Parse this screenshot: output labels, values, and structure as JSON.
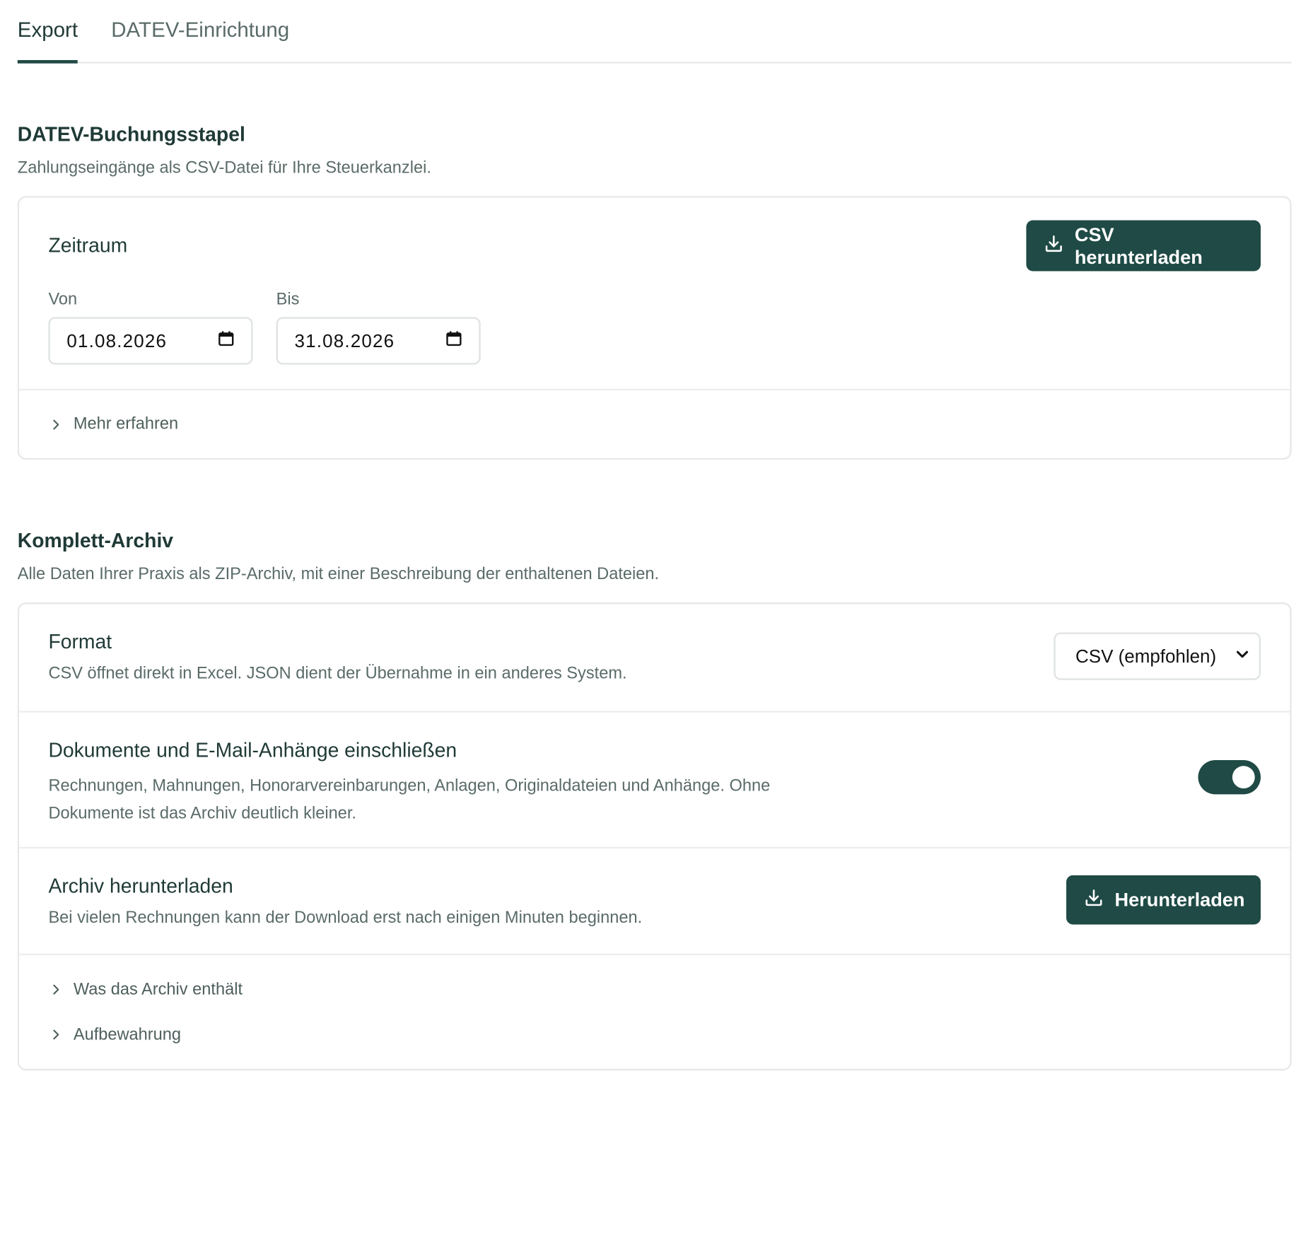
{
  "tabs": [
    {
      "label": "Export",
      "active": true
    },
    {
      "label": "DATEV-Einrichtung",
      "active": false
    }
  ],
  "datev": {
    "title": "DATEV-Buchungsstapel",
    "subtitle": "Zahlungseingänge als CSV-Datei für Ihre Steuerkanzlei.",
    "period_title": "Zeitraum",
    "download_button": "CSV herunterladen",
    "from_label": "Von",
    "from_value": "01.08.2026",
    "to_label": "Bis",
    "to_value": "31.08.2026",
    "more_info": "Mehr erfahren"
  },
  "archive": {
    "title": "Komplett-Archiv",
    "subtitle": "Alle Daten Ihrer Praxis als ZIP-Archiv, mit einer Beschreibung der enthaltenen Dateien.",
    "format_title": "Format",
    "format_desc": "CSV öffnet direkt in Excel. JSON dient der Übernahme in ein anderes System.",
    "format_selected": "CSV (empfohlen)",
    "docs_title": "Dokumente und E-Mail-Anhänge einschließen",
    "docs_desc": "Rechnungen, Mahnungen, Honorarvereinbarungen, Anlagen, Originaldateien und Anhänge. Ohne Dokumente ist das Archiv deutlich kleiner.",
    "docs_enabled": true,
    "download_title": "Archiv herunterladen",
    "download_desc": "Bei vielen Rechnungen kann der Download erst nach einigen Minuten beginnen.",
    "download_button": "Herunterladen",
    "details": [
      "Was das Archiv enthält",
      "Aufbewahrung"
    ]
  },
  "icons": {
    "download": "download-icon",
    "calendar": "calendar-icon",
    "chevron_right": "chevron-right-icon",
    "chevron_down": "chevron-down-icon"
  },
  "colors": {
    "accent": "#1f4a45",
    "text": "#1f3a36",
    "muted": "#5a6b69",
    "border": "#e6e9e8"
  }
}
